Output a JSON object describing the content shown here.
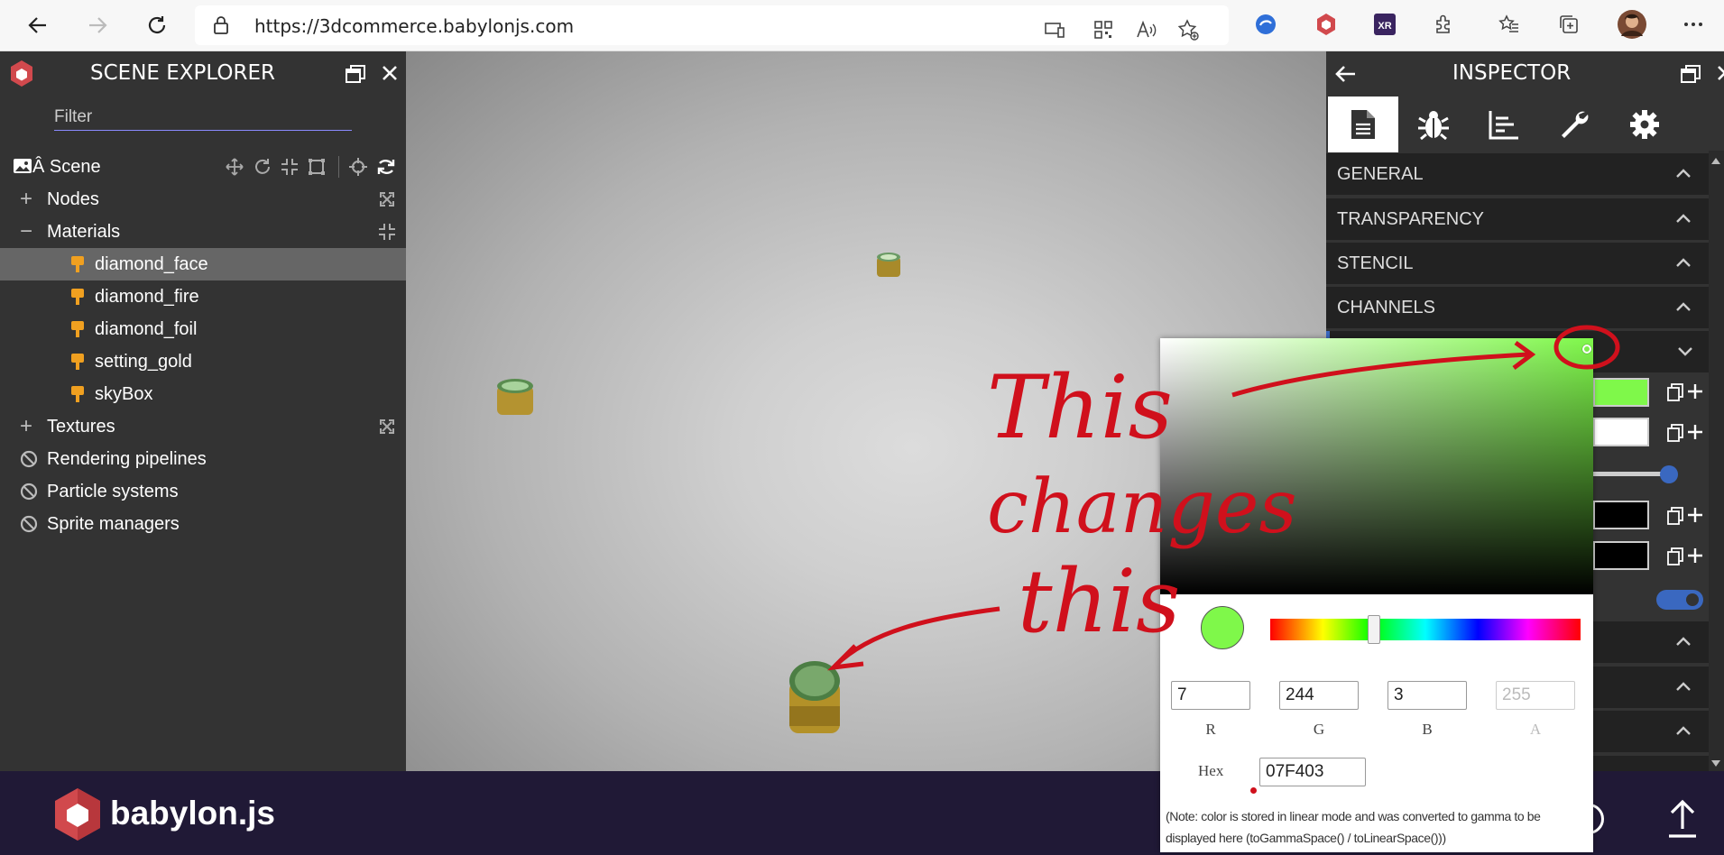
{
  "browser": {
    "url": "https://3dcommerce.babylonjs.com",
    "icons": [
      "back-icon",
      "forward-icon",
      "refresh-icon",
      "lock-icon",
      "app-available-icon",
      "qr-code-icon",
      "read-aloud-icon",
      "add-favorite-icon",
      "edge-extension-icon",
      "babylon-extension-icon",
      "xr-extension-icon",
      "extensions-icon",
      "favorites-icon",
      "collections-icon",
      "profile-avatar",
      "more-icon"
    ]
  },
  "scene_explorer": {
    "title": "SCENE EXPLORER",
    "filter_placeholder": "Filter",
    "scene_label": "Â Scene",
    "items": [
      {
        "label": "Nodes",
        "expander": "+"
      },
      {
        "label": "Materials",
        "expander": "−"
      },
      {
        "label": "Textures",
        "expander": "+"
      },
      {
        "label": "Rendering pipelines"
      },
      {
        "label": "Particle systems"
      },
      {
        "label": "Sprite managers"
      }
    ],
    "materials": [
      "diamond_face",
      "diamond_fire",
      "diamond_foil",
      "setting_gold",
      "skyBox"
    ],
    "selected_material": "diamond_face"
  },
  "inspector": {
    "title": "INSPECTOR",
    "tabs": [
      "properties-tab",
      "debug-tab",
      "statistics-tab",
      "tools-tab",
      "settings-tab"
    ],
    "sections": [
      "GENERAL",
      "TRANSPARENCY",
      "STENCIL",
      "CHANNELS"
    ],
    "accent": "#7ff84a"
  },
  "color_picker": {
    "r": "7",
    "g": "244",
    "b": "3",
    "a": "255",
    "r_label": "R",
    "g_label": "G",
    "b_label": "B",
    "a_label": "A",
    "hex_label": "Hex",
    "hex": "07F403",
    "note": "(Note: color is stored in linear mode and was converted to gamma to be displayed here (toGammaSpace() / toLinearSpace()))",
    "swatch_color": "#7ff84a"
  },
  "annotation": {
    "line1": "This",
    "line2": "changes",
    "line3": "this",
    "color": "#d0101c"
  },
  "footer": {
    "logo_text": "babylon.js"
  }
}
